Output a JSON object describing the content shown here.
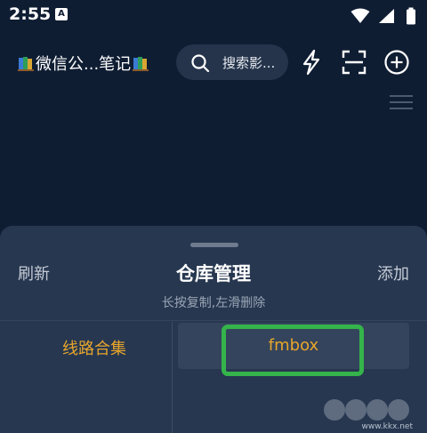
{
  "status_bar": {
    "time": "2:55",
    "notification_icon_letter": "A"
  },
  "top_bar": {
    "title": "微信公...笔记",
    "search_placeholder": "搜索影..."
  },
  "sheet": {
    "refresh_label": "刷新",
    "title": "仓库管理",
    "add_label": "添加",
    "subtitle": "长按复制,左滑删除",
    "categories": [
      {
        "label": "线路合集"
      }
    ],
    "repositories": [
      {
        "label": "fmbox"
      }
    ]
  },
  "watermark": {
    "text": "www.kkx.net"
  },
  "colors": {
    "background": "#0f1d33",
    "sheet": "#273750",
    "accent": "#e8a62b",
    "highlight": "#34b44a"
  }
}
